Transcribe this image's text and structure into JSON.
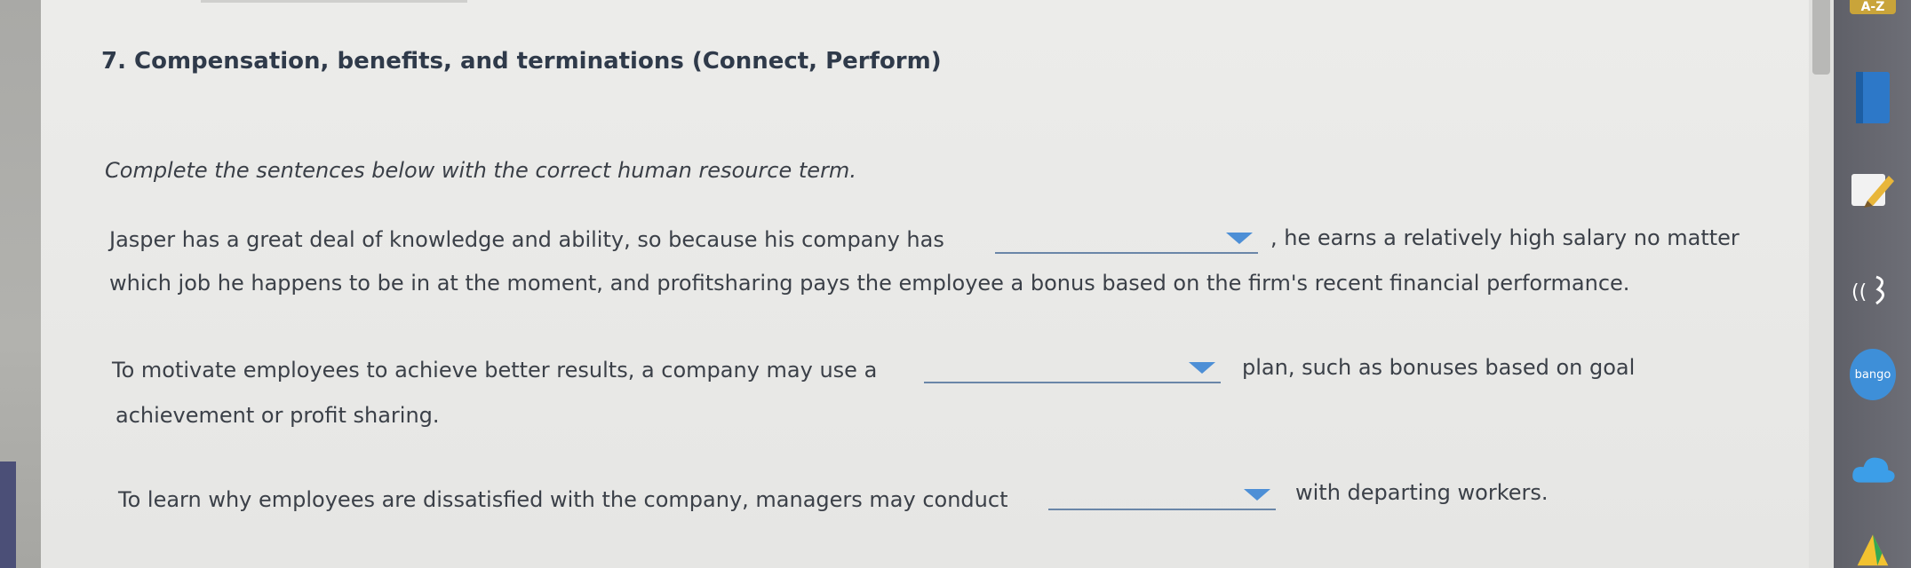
{
  "question": {
    "title": "7. Compensation, benefits, and terminations (Connect, Perform)",
    "instructions": "Complete the sentences below with the correct human resource term."
  },
  "sentences": [
    {
      "before": "Jasper has a great deal of knowledge and ability, so because his company has",
      "after": ", he earns a relatively high salary no matter",
      "continuation": "which job he happens to be in at the moment, and profitsharing pays the employee a bonus based on the firm's recent financial performance."
    },
    {
      "before": "To motivate employees to achieve better results, a company may use a",
      "after": "plan, such as bonuses based on goal",
      "continuation": "achievement or profit sharing."
    },
    {
      "before": "To learn why employees are dissatisfied with the company, managers may conduct",
      "after": "with departing workers.",
      "continuation": ""
    }
  ],
  "dock": {
    "items": [
      {
        "icon": "dictionary-icon",
        "label": "A-Z"
      },
      {
        "icon": "book-icon"
      },
      {
        "icon": "pencil-icon"
      },
      {
        "icon": "audio-icon"
      },
      {
        "icon": "bango-icon",
        "label": "bango"
      },
      {
        "icon": "cloud-icon"
      },
      {
        "icon": "drive-icon"
      }
    ]
  },
  "colors": {
    "title": "#2f3a4a",
    "dropdown_arrow": "#4d8fd6",
    "dropdown_line": "#6a86a8",
    "dock_bg": "#656670"
  }
}
